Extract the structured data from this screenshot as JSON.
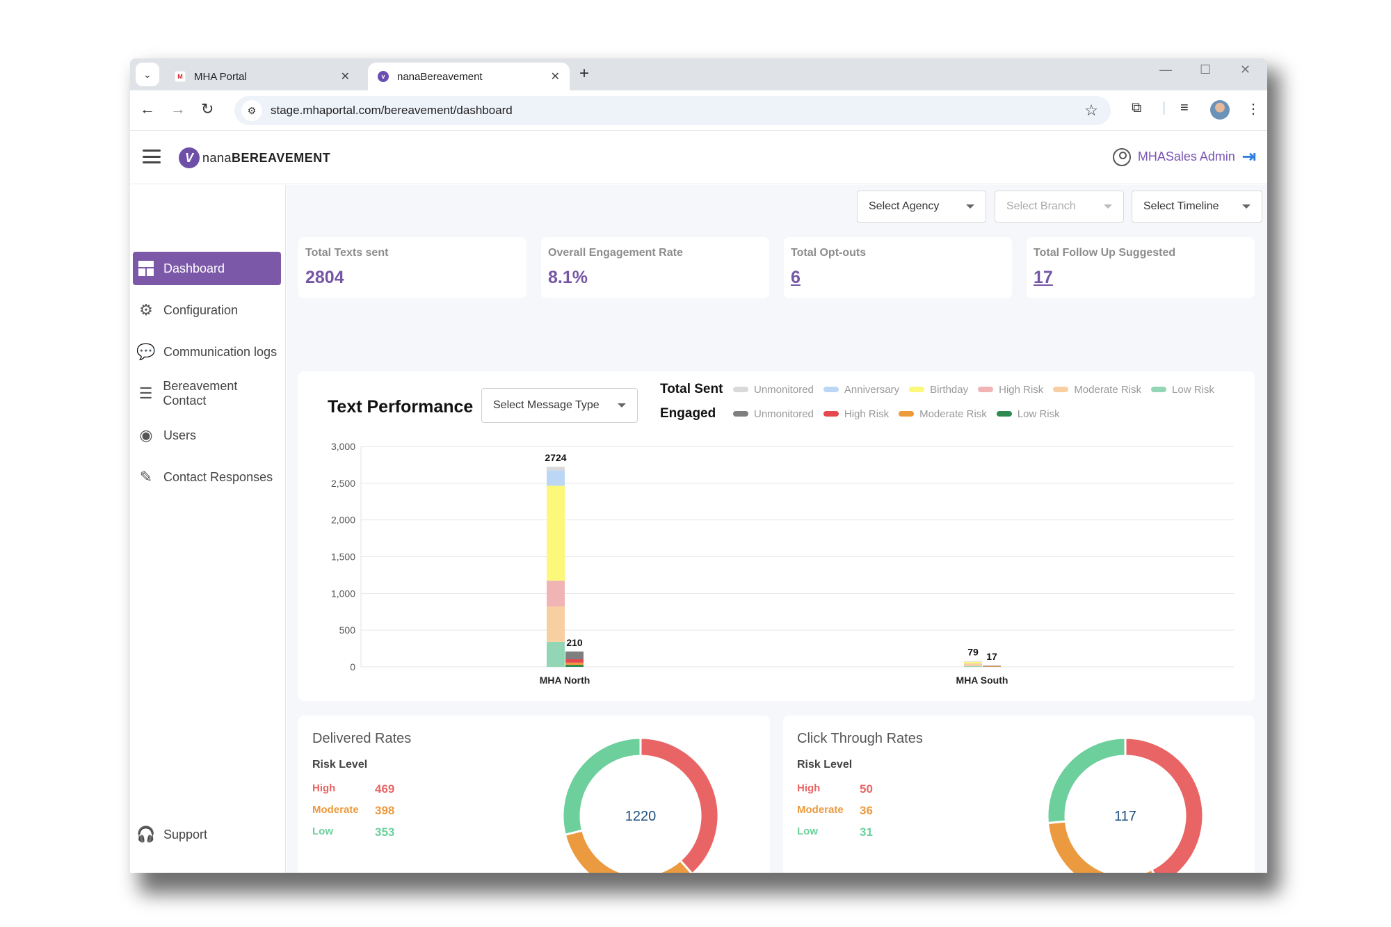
{
  "browser": {
    "tabs": [
      {
        "label": "MHA Portal",
        "favicon": "mha-favicon",
        "active": false
      },
      {
        "label": "nanaBereavement",
        "favicon": "nana-favicon",
        "active": true
      }
    ],
    "new_tab": "+",
    "url": "stage.mhaportal.com/bereavement/dashboard"
  },
  "header": {
    "logo_prefix": "nana",
    "logo_suffix": "BEREAVEMENT",
    "user_name": "MHASales Admin"
  },
  "sidebar": {
    "items": [
      {
        "label": "Dashboard",
        "icon": "dashboard-icon",
        "active": true
      },
      {
        "label": "Configuration",
        "icon": "gear-icon"
      },
      {
        "label": "Communication logs",
        "icon": "chat-icon"
      },
      {
        "label": "Bereavement Contact",
        "icon": "contact-list-icon"
      },
      {
        "label": "Users",
        "icon": "user-circle-icon"
      },
      {
        "label": "Contact Responses",
        "icon": "response-icon"
      }
    ],
    "support": "Support"
  },
  "filters": {
    "agency": "Select Agency",
    "branch": "Select Branch",
    "timeline": "Select Timeline"
  },
  "stats": [
    {
      "label": "Total Texts sent",
      "value": "2804",
      "link": false
    },
    {
      "label": "Overall Engagement Rate",
      "value": "8.1%",
      "link": false
    },
    {
      "label": "Total Opt-outs",
      "value": "6",
      "link": true
    },
    {
      "label": "Total Follow Up Suggested",
      "value": "17",
      "link": true
    }
  ],
  "text_performance": {
    "title": "Text Performance",
    "message_type_select": "Select Message Type",
    "legend": {
      "sent_title": "Total Sent",
      "engaged_title": "Engaged",
      "sent_items": [
        {
          "label": "Unmonitored",
          "color": "#d9d9d9"
        },
        {
          "label": "Anniversary",
          "color": "#bcd7f5"
        },
        {
          "label": "Birthday",
          "color": "#fbf87a"
        },
        {
          "label": "High Risk",
          "color": "#f0b4b4"
        },
        {
          "label": "Moderate Risk",
          "color": "#f8cfa0"
        },
        {
          "label": "Low Risk",
          "color": "#93d6b6"
        }
      ],
      "engaged_items": [
        {
          "label": "Unmonitored",
          "color": "#7f7f7f"
        },
        {
          "label": "High Risk",
          "color": "#e5484d"
        },
        {
          "label": "Moderate Risk",
          "color": "#ee9a3a"
        },
        {
          "label": "Low Risk",
          "color": "#2f8a52"
        }
      ]
    }
  },
  "chart_data": [
    {
      "type": "bar",
      "title": "Text Performance",
      "stacked": true,
      "categories": [
        "MHA North",
        "MHA South"
      ],
      "ylim": [
        0,
        3000
      ],
      "yticks": [
        0,
        500,
        1000,
        1500,
        2000,
        2500,
        3000
      ],
      "ytick_labels": [
        "0",
        "500",
        "1,000",
        "1,500",
        "2,000",
        "2,500",
        "3,000"
      ],
      "grid": true,
      "legend_position": "top-right",
      "groups": [
        {
          "name": "Total Sent",
          "totals": [
            2724,
            79
          ],
          "series": [
            {
              "name": "Low Risk",
              "color": "#93d6b6",
              "values": [
                342,
                10
              ]
            },
            {
              "name": "Moderate Risk",
              "color": "#f8cfa0",
              "values": [
                479,
                25
              ]
            },
            {
              "name": "High Risk",
              "color": "#f0b4b4",
              "values": [
                354,
                10
              ]
            },
            {
              "name": "Birthday",
              "color": "#fbf87a",
              "values": [
                1290,
                24
              ]
            },
            {
              "name": "Anniversary",
              "color": "#bcd7f5",
              "values": [
                208,
                5
              ]
            },
            {
              "name": "Unmonitored",
              "color": "#d9d9d9",
              "values": [
                51,
                5
              ]
            }
          ]
        },
        {
          "name": "Engaged",
          "totals": [
            210,
            17
          ],
          "series": [
            {
              "name": "Low Risk",
              "color": "#2f8a52",
              "values": [
                28,
                3
              ]
            },
            {
              "name": "Moderate Risk",
              "color": "#ee9a3a",
              "values": [
                30,
                6
              ]
            },
            {
              "name": "High Risk",
              "color": "#e5484d",
              "values": [
                46,
                4
              ]
            },
            {
              "name": "Unmonitored",
              "color": "#7f7f7f",
              "values": [
                106,
                4
              ]
            }
          ]
        }
      ]
    },
    {
      "type": "pie",
      "title": "Delivered Rates",
      "subtitle": "Risk Level",
      "center_label": "1220",
      "categories": [
        "High",
        "Moderate",
        "Low"
      ],
      "values": [
        469,
        398,
        353
      ],
      "colors": [
        "#e96565",
        "#ec9a3f",
        "#6ccf9c"
      ]
    },
    {
      "type": "pie",
      "title": "Click Through Rates",
      "subtitle": "Risk Level",
      "center_label": "117",
      "categories": [
        "High",
        "Moderate",
        "Low"
      ],
      "values": [
        50,
        36,
        31
      ],
      "colors": [
        "#e96565",
        "#ec9a3f",
        "#6ccf9c"
      ]
    }
  ]
}
